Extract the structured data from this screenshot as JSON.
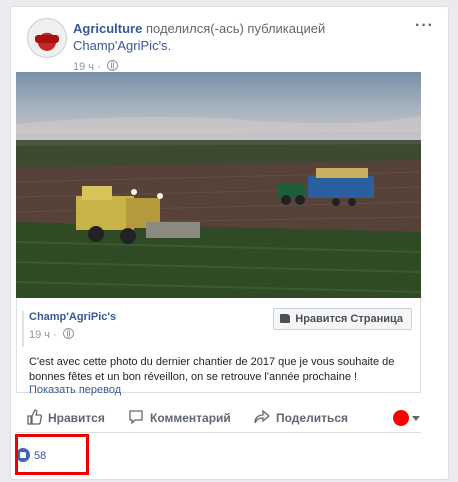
{
  "post": {
    "author": "Agriculture",
    "shared_text": "поделился(-ась) публикацией",
    "shared_page": "Champ'AgriPic's",
    "time": "19 ч",
    "more_icon": "ellipsis-icon"
  },
  "shared_post": {
    "page_name": "Champ'AgriPic's",
    "time": "19 ч",
    "like_page_label": "Нравится Страница",
    "text": "C'est avec cette photo du dernier chantier de 2017 que je vous souhaite de bonnes fêtes et un bon réveillon, on se retrouve l'année prochaine !",
    "translate_label": "Показать перевод"
  },
  "actions": {
    "like": "Нравится",
    "comment": "Комментарий",
    "share": "Поделиться"
  },
  "reactions": {
    "count": "58"
  },
  "colors": {
    "link": "#385898",
    "highlight": "#e00000",
    "reaction_dot": "#ff0000"
  }
}
